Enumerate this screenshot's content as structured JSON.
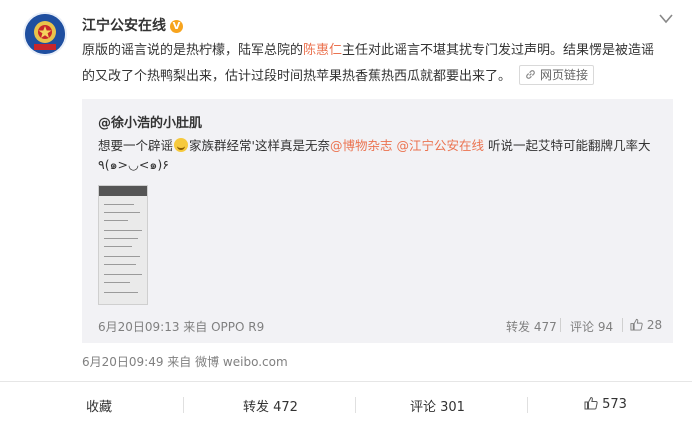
{
  "post": {
    "author": "江宁公安在线",
    "verified_badge": "V",
    "text_part1": "原版的谣言说的是热柠檬，陆军总院的",
    "mention_name": "陈惠仁",
    "text_part2": "主任对此谣言不堪其扰专门发过声明。结果愣是被造谣的又改了个热鸭梨出来，估计过段时间热苹果热香蕉热西瓜就都要出来了。",
    "web_link_label": "网页链接",
    "meta": "6月20日09:49 来自 微博 weibo.com"
  },
  "quoted": {
    "author": "@徐小浩的小肚肌",
    "text_a": "想要一个辟谣",
    "text_b": "家族群经常'这样真是无奈",
    "link1": "@博物杂志",
    "link2": "@江宁公安在线",
    "text_c": " 听说一起艾特可能翻牌几率大٩(๑>◡<๑)۶",
    "meta": "6月20日09:13 来自 OPPO R9",
    "repost_label": "转发 477",
    "comment_label": "评论 94",
    "like_count": "28"
  },
  "footer": {
    "collect": "收藏",
    "repost": "转发 472",
    "comment": "评论 301",
    "like": "573"
  },
  "colors": {
    "link": "#eb7350",
    "quote_bg": "#f2f2f5",
    "meta": "#808080"
  },
  "icons": [
    "police-badge-avatar",
    "verified-icon",
    "chevron-down-icon",
    "link-icon",
    "laugh-emoji-icon",
    "thumbs-up-icon"
  ]
}
